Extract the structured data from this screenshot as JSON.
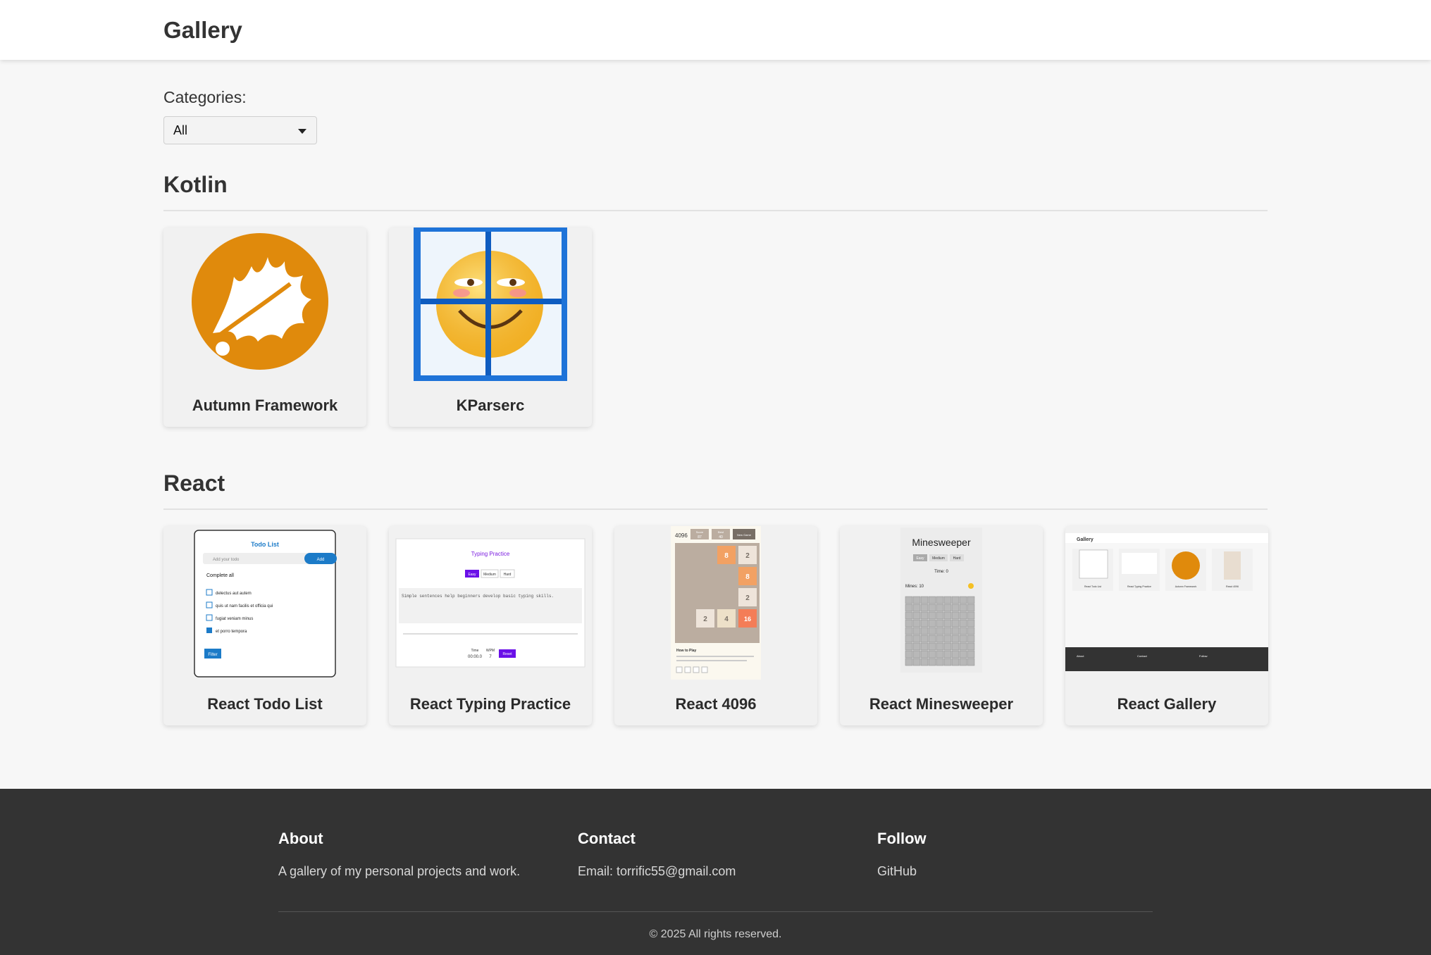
{
  "header": {
    "title": "Gallery"
  },
  "filter": {
    "label": "Categories:",
    "selected": "All"
  },
  "sections": [
    {
      "title": "Kotlin",
      "projects": [
        {
          "name": "Autumn Framework",
          "icon": "autumn-leaf-logo"
        },
        {
          "name": "KParserc",
          "icon": "smiley-window-logo"
        }
      ]
    },
    {
      "title": "React",
      "projects": [
        {
          "name": "React Todo List"
        },
        {
          "name": "React Typing Practice"
        },
        {
          "name": "React 4096"
        },
        {
          "name": "React Minesweeper"
        },
        {
          "name": "React Gallery"
        }
      ]
    }
  ],
  "thumbs": {
    "todo": {
      "title": "Todo List",
      "placeholder": "Add your todo",
      "add": "Add",
      "complete_all": "Complete all",
      "items": [
        "delectus aut autem",
        "quis ut nam facilis et officia qui",
        "fugiat veniam minus",
        "et porro tempora"
      ],
      "filter": "Filter"
    },
    "typing": {
      "title": "Typing Practice",
      "levels": [
        "Easy",
        "Medium",
        "Hard"
      ],
      "sentence": "Simple sentences help beginners develop basic typing skills.",
      "time_label": "Time",
      "time": "00:00.0",
      "wpm_label": "WPM",
      "wpm": "7",
      "reset": "Reset"
    },
    "game4096": {
      "title": "4096",
      "score_label": "Score",
      "score": "87",
      "best_label": "Best",
      "best": "40",
      "new_game": "New Game",
      "tiles": [
        "8",
        "2",
        "8",
        "2",
        "2",
        "4",
        "16"
      ],
      "how_to": "How to Play"
    },
    "minesweeper": {
      "title": "Minesweeper",
      "levels": [
        "Easy",
        "Medium",
        "Hard"
      ],
      "time": "Time: 0",
      "mines": "Mines: 10"
    },
    "gallery": {
      "title": "Gallery",
      "cards": [
        "React Todo List",
        "React Typing Practice",
        "Autumn Framework",
        "React 4096"
      ],
      "footer": [
        "About",
        "Contact",
        "Follow"
      ]
    }
  },
  "footer": {
    "about_title": "About",
    "about_text": "A gallery of my personal projects and work.",
    "contact_title": "Contact",
    "contact_text": "Email: torrific55@gmail.com",
    "follow_title": "Follow",
    "follow_link": "GitHub",
    "copyright": "© 2025 All rights reserved."
  },
  "colors": {
    "autumn_orange": "#e08a0c",
    "tile_orange": "#f2a163",
    "tile_red": "#f47d57",
    "purple_button": "#6a10e8",
    "blue_button": "#1c7bc8",
    "footer_bg": "#333333"
  }
}
